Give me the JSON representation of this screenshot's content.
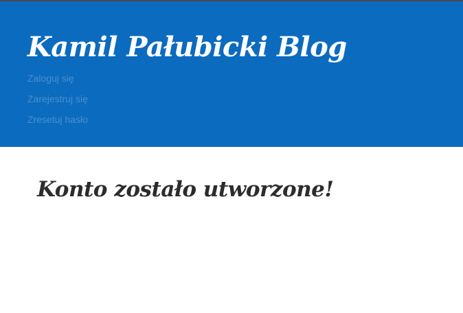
{
  "header": {
    "site_title": "Kamil Pałubicki Blog",
    "nav": [
      {
        "label": "Zaloguj się"
      },
      {
        "label": "Zarejestruj się"
      },
      {
        "label": "Zresetuj hasło"
      }
    ]
  },
  "main": {
    "heading": "Konto zostało utworzone!"
  },
  "colors": {
    "header_background": "#0b6bbf",
    "nav_link": "#4b90cf",
    "title_text": "#ffffff",
    "heading_text": "#2c2c2c"
  }
}
